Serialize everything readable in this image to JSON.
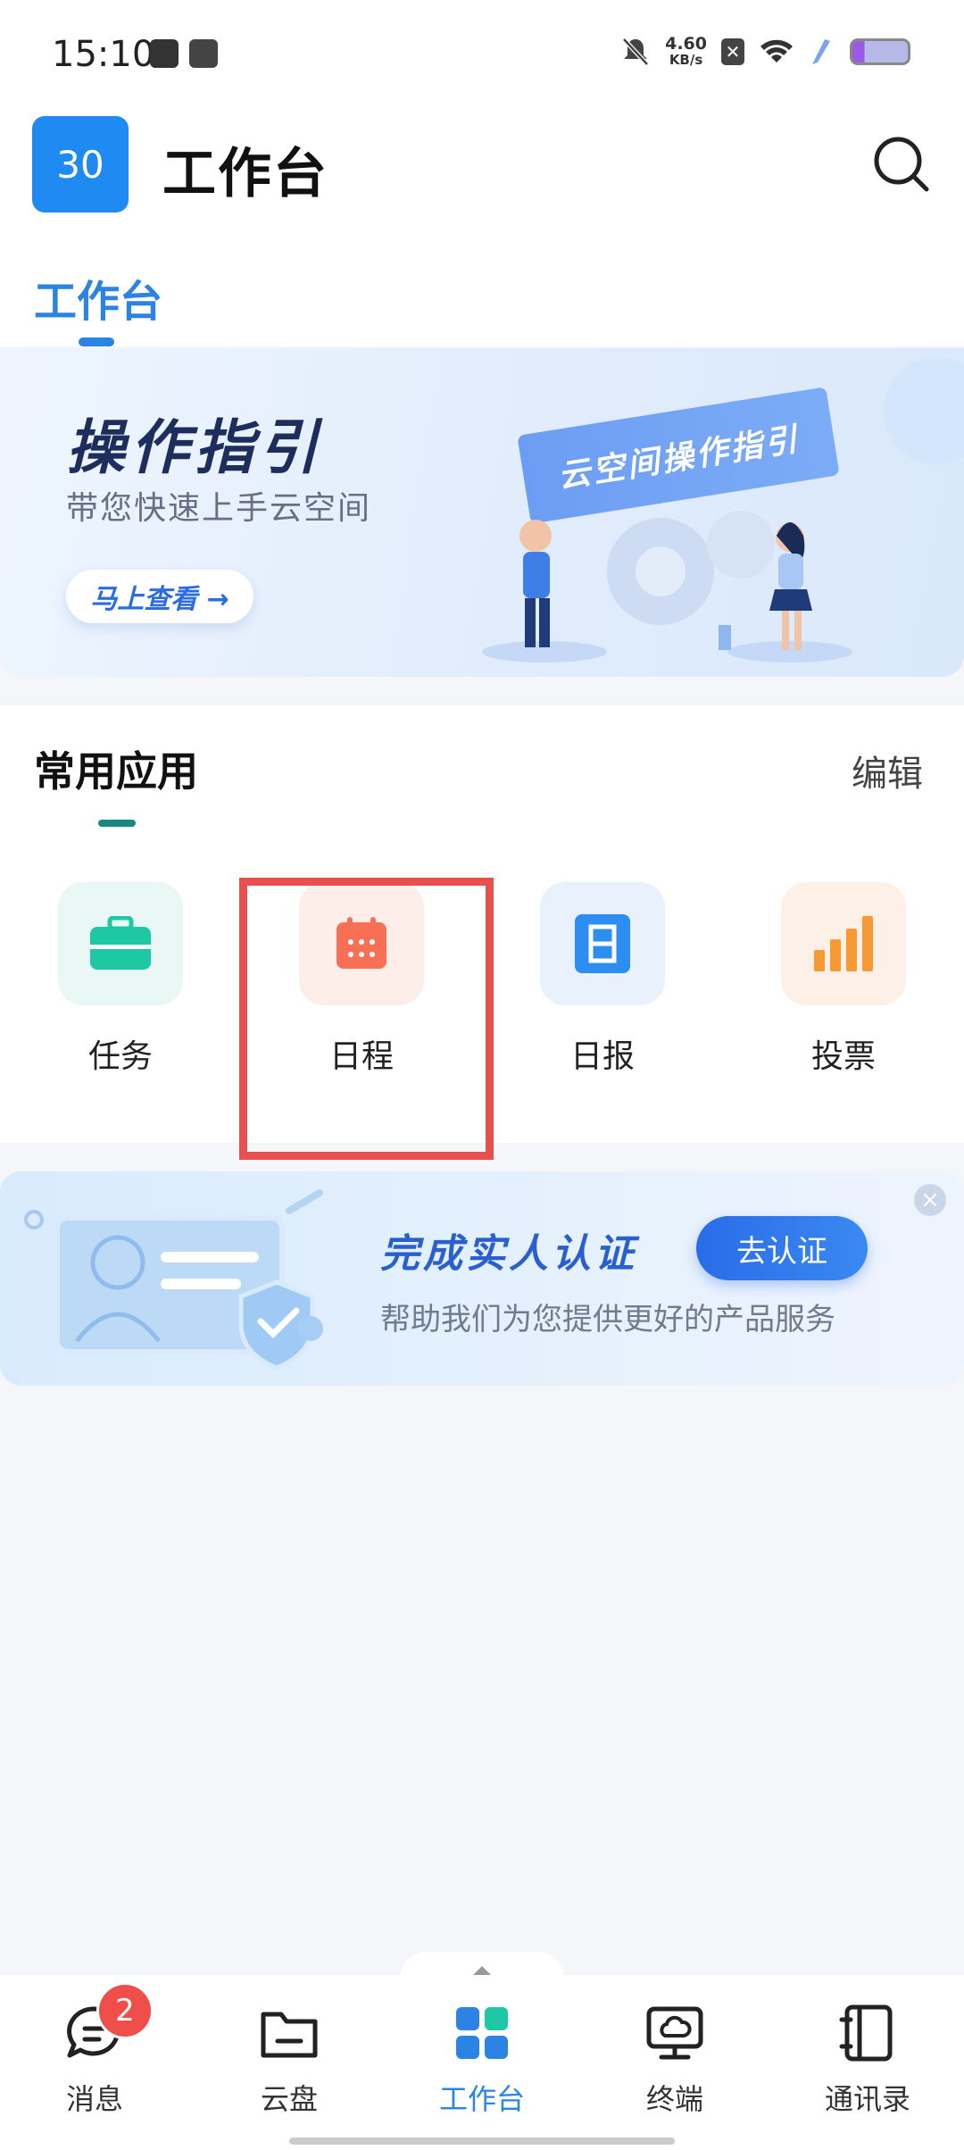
{
  "status_bar": {
    "time": "15:10",
    "net_speed": "4.60",
    "net_unit": "KB/s"
  },
  "header": {
    "avatar_text": "30",
    "title": "工作台"
  },
  "tabs": [
    {
      "label": "工作台",
      "active": true
    }
  ],
  "guide_banner": {
    "title": "操作指引",
    "subtitle": "带您快速上手云空间",
    "button": "马上查看 →",
    "sign_text": "云空间操作指引"
  },
  "common_apps": {
    "title": "常用应用",
    "edit": "编辑",
    "items": [
      {
        "label": "任务",
        "icon": "briefcase-icon",
        "color": "#1ec8a5",
        "bg": "#e9f8f4"
      },
      {
        "label": "日程",
        "icon": "calendar-icon",
        "color": "#f77056",
        "bg": "#fdeeea"
      },
      {
        "label": "日报",
        "icon": "daily-report-icon",
        "color": "#2c8ef0",
        "bg": "#e8f1fc"
      },
      {
        "label": "投票",
        "icon": "vote-chart-icon",
        "color": "#f59a34",
        "bg": "#fdf1e7"
      }
    ]
  },
  "auth_banner": {
    "title": "完成实人认证",
    "subtitle": "帮助我们为您提供更好的产品服务",
    "button": "去认证"
  },
  "bottom_nav": {
    "badge_count": "2",
    "items": [
      {
        "label": "消息",
        "icon": "message-icon",
        "active": false
      },
      {
        "label": "云盘",
        "icon": "folder-icon",
        "active": false
      },
      {
        "label": "工作台",
        "icon": "workbench-icon",
        "active": true
      },
      {
        "label": "终端",
        "icon": "terminal-cloud-icon",
        "active": false
      },
      {
        "label": "通讯录",
        "icon": "contacts-book-icon",
        "active": false
      }
    ]
  },
  "colors": {
    "accent": "#2b83e3",
    "highlight": "#e8504f"
  }
}
